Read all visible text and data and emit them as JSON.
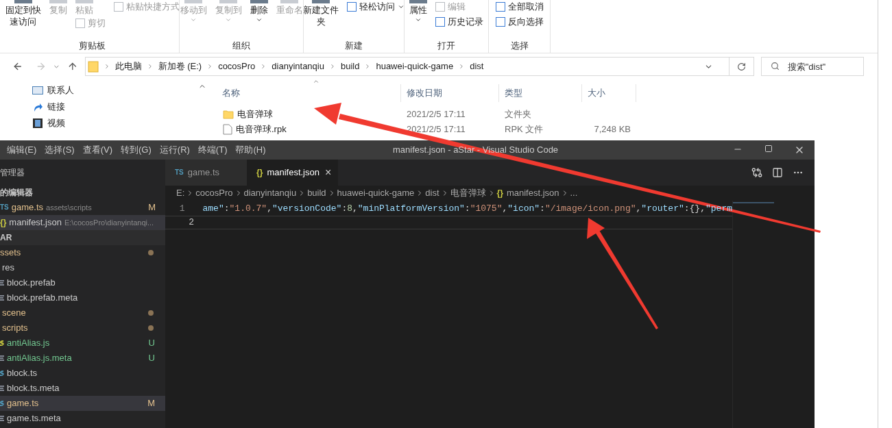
{
  "explorer": {
    "ribbon": {
      "groups": [
        {
          "label": "剪贴板",
          "columns": [
            [
              {
                "label": "固定到快速访问",
                "kind": "large",
                "disabled": false,
                "has_menu": false
              }
            ],
            [
              {
                "label": "复制",
                "kind": "large",
                "disabled": true,
                "has_menu": false
              }
            ],
            [
              {
                "label": "粘贴",
                "kind": "large",
                "disabled": true,
                "has_menu": false
              },
              {
                "label": "剪切",
                "kind": "small",
                "disabled": true,
                "has_menu": false
              }
            ],
            [
              {
                "label": "粘贴快捷方式",
                "kind": "small",
                "disabled": true,
                "has_menu": false
              }
            ]
          ]
        },
        {
          "label": "组织",
          "columns": [
            [
              {
                "label": "移动到",
                "kind": "large",
                "disabled": true,
                "has_menu": true
              }
            ],
            [
              {
                "label": "复制到",
                "kind": "large",
                "disabled": true,
                "has_menu": true
              }
            ],
            [
              {
                "label": "删除",
                "kind": "large",
                "disabled": false,
                "has_menu": true
              }
            ],
            [
              {
                "label": "重命名",
                "kind": "large",
                "disabled": true,
                "has_menu": false
              }
            ]
          ]
        },
        {
          "label": "新建",
          "columns": [
            [
              {
                "label": "新建文件夹",
                "kind": "large",
                "disabled": false,
                "has_menu": false
              }
            ],
            [
              {
                "label": "轻松访问",
                "kind": "small",
                "disabled": false,
                "has_menu": true
              }
            ]
          ]
        },
        {
          "label": "打开",
          "columns": [
            [
              {
                "label": "属性",
                "kind": "large",
                "disabled": false,
                "has_menu": true
              }
            ],
            [
              {
                "label": "编辑",
                "kind": "small",
                "disabled": true,
                "has_menu": false
              },
              {
                "label": "历史记录",
                "kind": "small",
                "disabled": false,
                "has_menu": false
              }
            ]
          ]
        },
        {
          "label": "选择",
          "columns": [
            [
              {
                "label": "全部取消",
                "kind": "small",
                "disabled": false,
                "has_menu": false
              },
              {
                "label": "反向选择",
                "kind": "small",
                "disabled": false,
                "has_menu": false
              }
            ]
          ]
        }
      ]
    },
    "address": {
      "crumbs": [
        "此电脑",
        "新加卷 (E:)",
        "cocosPro",
        "dianyintanqiu",
        "build",
        "huawei-quick-game",
        "dist"
      ],
      "forward_disabled": true
    },
    "search": {
      "placeholder": "搜索\"dist\""
    },
    "nav_items": [
      {
        "label": "联系人",
        "kind": "contacts"
      },
      {
        "label": "链接",
        "kind": "link"
      },
      {
        "label": "视频",
        "kind": "video"
      }
    ],
    "columns": [
      "名称",
      "修改日期",
      "类型",
      "大小"
    ],
    "files": [
      {
        "name": "电音弹球",
        "modified": "2021/2/5 17:11",
        "type": "文件夹",
        "kind": "folder"
      },
      {
        "name": "电音弹球.rpk",
        "modified": "2021/2/5 17:11",
        "type": "RPK 文件",
        "size": "7,248 KB",
        "kind": "file"
      }
    ]
  },
  "vscode": {
    "menu": [
      "编辑(E)",
      "选择(S)",
      "查看(V)",
      "转到(G)",
      "运行(R)",
      "终端(T)",
      "帮助(H)"
    ],
    "title": "manifest.json - aStar - Visual Studio Code",
    "sidebar": {
      "title": "管理器",
      "open_editors_title": "的编辑器",
      "open_editors": [
        {
          "name": "game.ts",
          "description": "assets\\scripts",
          "icon_text": "TS",
          "kind": "ts",
          "badge": "M",
          "color": "#e2c08d",
          "selected": false
        },
        {
          "name": "manifest.json",
          "description": "E:\\cocosPro\\dianyintanqi...",
          "icon_text": "{}",
          "kind": "json",
          "color": "#cccccc",
          "selected": true
        }
      ],
      "folder_title": "AR",
      "tree": [
        {
          "label": "ssets",
          "kind": "folder",
          "dot": true,
          "color": "#e2c08d",
          "selected": false,
          "children": [
            {
              "label": "res",
              "kind": "folder",
              "dot": false,
              "color": "#cccccc",
              "selected": false,
              "children": [
                {
                  "label": "block.prefab",
                  "kind": "lines",
                  "color": "#cccccc",
                  "selected": false
                },
                {
                  "label": "block.prefab.meta",
                  "kind": "lines",
                  "color": "#cccccc",
                  "selected": false
                }
              ]
            },
            {
              "label": "scene",
              "kind": "folder",
              "dot": true,
              "color": "#e2c08d",
              "selected": false
            },
            {
              "label": "scripts",
              "kind": "folder",
              "dot": true,
              "color": "#e2c08d",
              "selected": false,
              "children": [
                {
                  "label": "antiAlias.js",
                  "kind": "js",
                  "badge": "U",
                  "color": "#73c991",
                  "selected": false
                },
                {
                  "label": "antiAlias.js.meta",
                  "kind": "lines",
                  "badge": "U",
                  "color": "#73c991",
                  "selected": false
                },
                {
                  "label": "block.ts",
                  "kind": "ts",
                  "color": "#cccccc",
                  "selected": false
                },
                {
                  "label": "block.ts.meta",
                  "kind": "lines",
                  "color": "#cccccc",
                  "selected": false
                },
                {
                  "label": "game.ts",
                  "kind": "ts",
                  "badge": "M",
                  "color": "#e2c08d",
                  "selected": true
                },
                {
                  "label": "game.ts.meta",
                  "kind": "lines",
                  "color": "#cccccc",
                  "selected": false
                }
              ]
            }
          ]
        }
      ]
    },
    "tabs": [
      {
        "label": "game.ts",
        "icon_text": "TS",
        "kind": "ts",
        "selected": false
      },
      {
        "label": "manifest.json",
        "icon_text": "{}",
        "kind": "json",
        "selected": true,
        "close": "×"
      }
    ],
    "breadcrumb": [
      {
        "label": "E:"
      },
      {
        "label": "cocosPro"
      },
      {
        "label": "dianyintanqiu"
      },
      {
        "label": "build"
      },
      {
        "label": "huawei-quick-game"
      },
      {
        "label": "dist"
      },
      {
        "label": "电音弹球"
      },
      {
        "label": "manifest.json",
        "icon_text": "{}"
      },
      {
        "label": "..."
      }
    ],
    "lines": [
      {
        "number": "1",
        "current": false,
        "tokens": [
          {
            "kind": "key",
            "text": "ame\""
          },
          {
            "kind": "punct",
            "text": ":"
          },
          {
            "kind": "string",
            "text": "\"1.0.7\""
          },
          {
            "kind": "punct",
            "text": ","
          },
          {
            "kind": "key",
            "text": "\"versionCode\""
          },
          {
            "kind": "punct",
            "text": ":"
          },
          {
            "kind": "number",
            "text": "8"
          },
          {
            "kind": "punct",
            "text": ","
          },
          {
            "kind": "key",
            "text": "\"minPlatformVersion\""
          },
          {
            "kind": "punct",
            "text": ":"
          },
          {
            "kind": "string",
            "text": "\"1075\""
          },
          {
            "kind": "punct",
            "text": ","
          },
          {
            "kind": "key",
            "text": "\"icon\""
          },
          {
            "kind": "punct",
            "text": ":"
          },
          {
            "kind": "string",
            "text": "\"/image/icon.png\""
          },
          {
            "kind": "punct",
            "text": ","
          },
          {
            "kind": "key",
            "text": "\"router\""
          },
          {
            "kind": "punct",
            "text": ":{},"
          },
          {
            "kind": "key",
            "text": "\"perm"
          }
        ]
      },
      {
        "number": "2",
        "current": true
      }
    ]
  }
}
